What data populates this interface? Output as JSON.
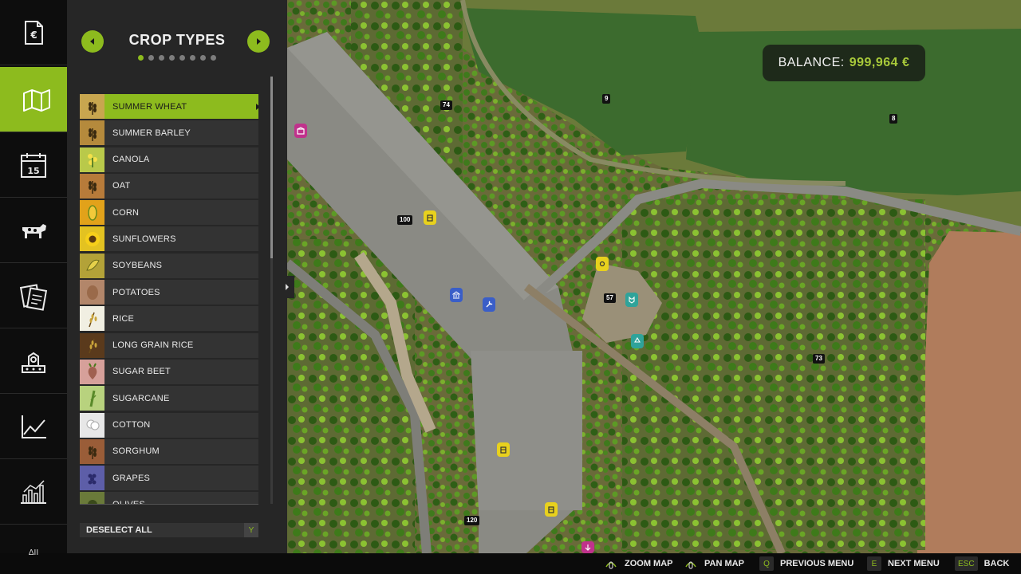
{
  "rail": {
    "items": [
      {
        "name": "finances",
        "icon": "euro-document-icon",
        "active": false
      },
      {
        "name": "map",
        "icon": "map-icon",
        "active": true
      },
      {
        "name": "calendar",
        "icon": "calendar-icon",
        "day": "15",
        "active": false
      },
      {
        "name": "animals",
        "icon": "cow-icon",
        "active": false
      },
      {
        "name": "contracts",
        "icon": "contracts-icon",
        "active": false
      },
      {
        "name": "production",
        "icon": "factory-icon",
        "active": false
      },
      {
        "name": "prices",
        "icon": "line-chart-icon",
        "active": false
      },
      {
        "name": "statistics",
        "icon": "bar-chart-icon",
        "active": false
      }
    ]
  },
  "panel": {
    "title": "CROP TYPES",
    "page_count": 8,
    "active_page": 1,
    "crops": [
      {
        "label": "SUMMER WHEAT",
        "icon": "wheat-icon",
        "color": "#c8a64f",
        "selected": true
      },
      {
        "label": "SUMMER BARLEY",
        "icon": "barley-icon",
        "color": "#b58a3c",
        "selected": false
      },
      {
        "label": "CANOLA",
        "icon": "canola-icon",
        "color": "#b9c94a",
        "selected": false
      },
      {
        "label": "OAT",
        "icon": "oat-icon",
        "color": "#b77b3a",
        "selected": false
      },
      {
        "label": "CORN",
        "icon": "corn-icon",
        "color": "#e2a21a",
        "selected": false
      },
      {
        "label": "SUNFLOWERS",
        "icon": "sunflower-icon",
        "color": "#e3c221",
        "selected": false
      },
      {
        "label": "SOYBEANS",
        "icon": "soybean-icon",
        "color": "#b3a238",
        "selected": false
      },
      {
        "label": "POTATOES",
        "icon": "potato-icon",
        "color": "#b2866a",
        "selected": false
      },
      {
        "label": "RICE",
        "icon": "rice-icon",
        "color": "#f1efe2",
        "selected": false
      },
      {
        "label": "LONG GRAIN RICE",
        "icon": "long-grain-rice-icon",
        "color": "#5a3a1c",
        "selected": false
      },
      {
        "label": "SUGAR BEET",
        "icon": "sugar-beet-icon",
        "color": "#d6a09a",
        "selected": false
      },
      {
        "label": "SUGARCANE",
        "icon": "sugarcane-icon",
        "color": "#b8d27e",
        "selected": false
      },
      {
        "label": "COTTON",
        "icon": "cotton-icon",
        "color": "#e7e7e7",
        "selected": false
      },
      {
        "label": "SORGHUM",
        "icon": "sorghum-icon",
        "color": "#9a5d38",
        "selected": false
      },
      {
        "label": "GRAPES",
        "icon": "grapes-icon",
        "color": "#5d5ea8",
        "selected": false
      },
      {
        "label": "OLIVES",
        "icon": "olive-icon",
        "color": "#6a7a3a",
        "selected": false
      }
    ],
    "deselect_label": "DESELECT ALL",
    "deselect_key": "Y"
  },
  "map": {
    "field_numbers": [
      "74",
      "9",
      "8",
      "100",
      "57",
      "73",
      "120"
    ],
    "hotspots": [
      {
        "name": "shop-hotspot",
        "color": "#c0328c"
      },
      {
        "name": "sell-point-hotspot-1",
        "color": "#e8d11d"
      },
      {
        "name": "bank-hotspot",
        "color": "#3a5ec8"
      },
      {
        "name": "garage-hotspot",
        "color": "#3a5ec8"
      },
      {
        "name": "gas-station-hotspot",
        "color": "#e8d11d"
      },
      {
        "name": "animal-dealer-hotspot",
        "color": "#2fa39a"
      },
      {
        "name": "recycling-hotspot",
        "color": "#2fa39a"
      },
      {
        "name": "sell-point-hotspot-2",
        "color": "#e8d11d"
      },
      {
        "name": "sell-point-hotspot-3",
        "color": "#e8d11d"
      },
      {
        "name": "farmer-hotspot",
        "color": "#c0328c"
      }
    ],
    "balance": {
      "label": "BALANCE:",
      "value": "999,964 €"
    }
  },
  "bottombar": {
    "rail_stub_text": "ΔII",
    "hints": [
      {
        "key_icon": "mouse-scroll-icon",
        "label": "ZOOM MAP"
      },
      {
        "key_icon": "mouse-drag-icon",
        "label": "PAN MAP"
      },
      {
        "key": "Q",
        "label": "PREVIOUS MENU"
      },
      {
        "key": "E",
        "label": "NEXT MENU"
      },
      {
        "key": "ESC",
        "label": "BACK"
      }
    ]
  },
  "colors": {
    "accent": "#8dbb1e",
    "panel": "#262626",
    "rail": "#0d0d0d"
  }
}
